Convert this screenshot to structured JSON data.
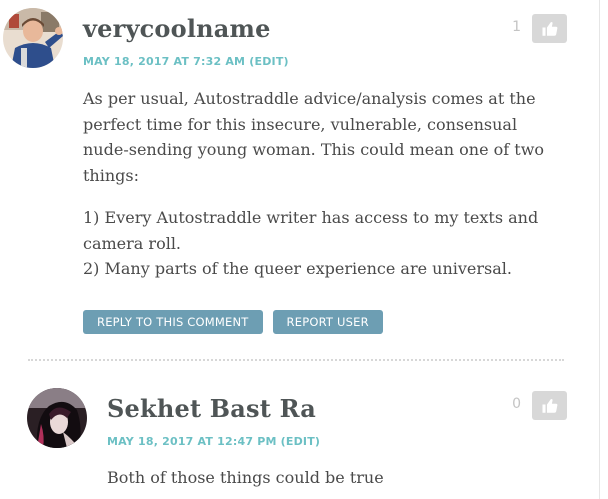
{
  "comments": [
    {
      "author": "verycoolname",
      "date": "MAY 18, 2017 AT 7:32 AM",
      "edit_label": "(EDIT)",
      "likes": "1",
      "paragraphs": [
        "As per usual, Autostraddle advice/analysis comes at the perfect time for this insecure, vulnerable, consensual nude-sending young woman. This could mean one of two things:",
        "1) Every Autostraddle writer has access to my texts and camera roll.",
        "2) Many parts of the queer experience are universal."
      ],
      "reply_label": "REPLY TO THIS COMMENT",
      "report_label": "REPORT USER"
    },
    {
      "author": "Sekhet Bast Ra",
      "date": "MAY 18, 2017 AT 12:47 PM",
      "edit_label": "(EDIT)",
      "likes": "0",
      "paragraphs": [
        "Both of those things could be true"
      ]
    }
  ],
  "icons": {
    "like": "thumbs-up-icon"
  },
  "colors": {
    "meta": "#6cc0c4",
    "action_button": "#6d9eb3",
    "like_button": "#d8d8d8",
    "author": "#4f5556"
  }
}
